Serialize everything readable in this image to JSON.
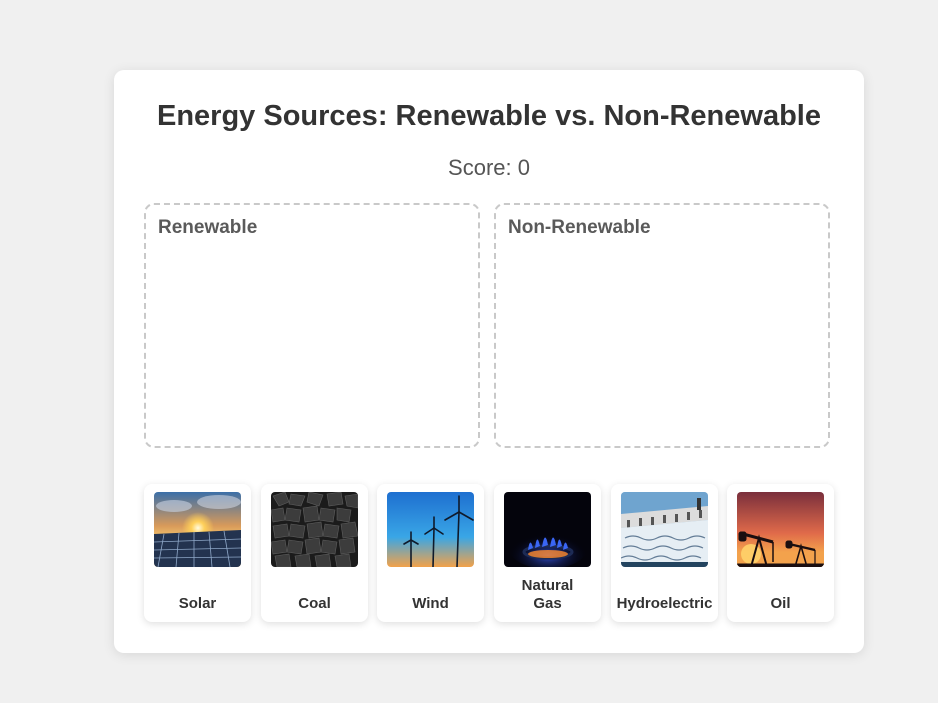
{
  "game": {
    "title": "Energy Sources: Renewable vs. Non-Renewable",
    "score_label": "Score: 0",
    "score": 0
  },
  "zones": [
    {
      "label": "Renewable"
    },
    {
      "label": "Non-Renewable"
    }
  ],
  "items": [
    {
      "label": "Solar",
      "icon": "solar-panel-image"
    },
    {
      "label": "Coal",
      "icon": "coal-image"
    },
    {
      "label": "Wind",
      "icon": "wind-turbine-image"
    },
    {
      "label_line1": "Natural",
      "label_line2": "Gas",
      "icon": "gas-flame-image"
    },
    {
      "label": "Hydroelectric",
      "icon": "dam-image"
    },
    {
      "label": "Oil",
      "icon": "oil-pump-image"
    }
  ],
  "colors": {
    "background": "#f0f0f0",
    "card": "#ffffff",
    "zone_border": "#c9c9c9",
    "text": "#333333"
  }
}
